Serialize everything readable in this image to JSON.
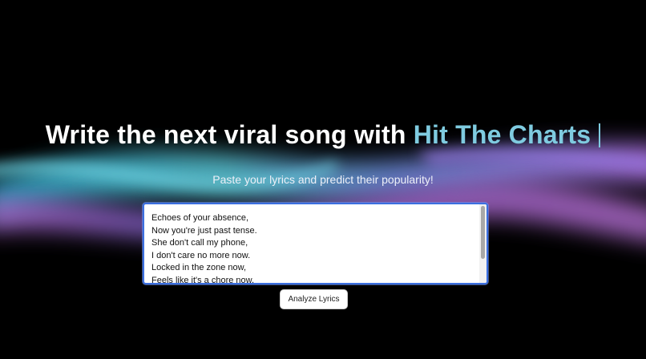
{
  "hero": {
    "headline_prefix": "Write the next viral song with ",
    "headline_brand": "Hit The Charts",
    "subtitle": "Paste your lyrics and predict their popularity!"
  },
  "lyrics_input": {
    "lines": [
      "Echoes of your absence,",
      "Now you're just past tense.",
      "She don't call my phone,",
      "I don't care no more now.",
      "Locked in the zone now,",
      "Feels like it's a chore now,"
    ]
  },
  "actions": {
    "analyze_label": "Analyze Lyrics"
  },
  "colors": {
    "background": "#000000",
    "accent": "#7fcbe0",
    "input_border": "#3b6fe0",
    "wave_purple": "#a86fe0",
    "wave_teal": "#5ac6d6"
  }
}
